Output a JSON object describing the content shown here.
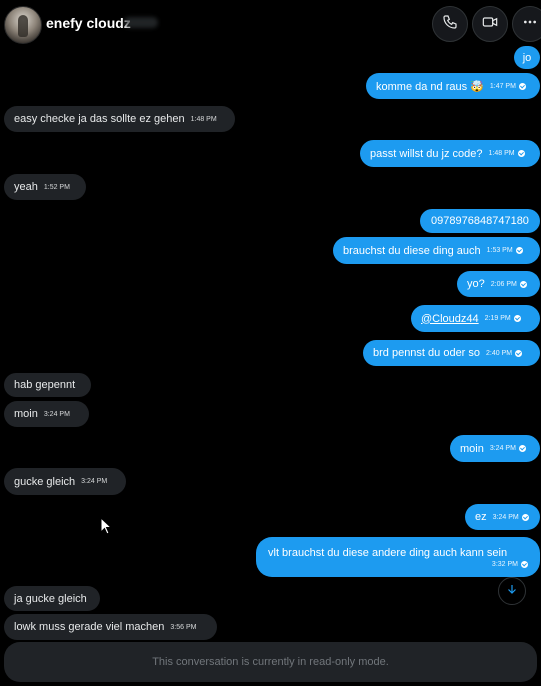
{
  "header": {
    "contact_name": "enefy cloudz",
    "phone_icon": "phone-icon",
    "video_icon": "video-icon",
    "more_icon": "more-horizontal-icon"
  },
  "messages": [
    {
      "dir": "out",
      "text": "jo",
      "time": ""
    },
    {
      "dir": "out",
      "text": "komme da nd raus 🤯",
      "time": "1:47 PM"
    },
    {
      "dir": "in",
      "text": "easy checke ja das sollte ez gehen",
      "time": "1:48 PM"
    },
    {
      "dir": "out",
      "text": "passt willst du jz code?",
      "time": "1:48 PM"
    },
    {
      "dir": "in",
      "text": "yeah",
      "time": "1:52 PM"
    },
    {
      "dir": "out",
      "text": "0978976848747180",
      "time": ""
    },
    {
      "dir": "out",
      "text": "brauchst du diese ding auch",
      "time": "1:53 PM"
    },
    {
      "dir": "out",
      "text": "yo?",
      "time": "2:06 PM"
    },
    {
      "dir": "out",
      "text": "@Cloudz44",
      "time": "2:19 PM"
    },
    {
      "dir": "out",
      "text": "brd pennst du oder so",
      "time": "2:40 PM"
    },
    {
      "dir": "in",
      "text": "hab gepennt",
      "time": ""
    },
    {
      "dir": "in",
      "text": "moin",
      "time": "3:24 PM"
    },
    {
      "dir": "out",
      "text": "moin",
      "time": "3:24 PM"
    },
    {
      "dir": "in",
      "text": "gucke gleich",
      "time": "3:24 PM"
    },
    {
      "dir": "out",
      "text": "ez",
      "time": "3:24 PM"
    },
    {
      "dir": "out",
      "text": "vlt brauchst du diese andere ding auch kann sein",
      "time": "3:32 PM"
    },
    {
      "dir": "in",
      "text": "ja gucke gleich",
      "time": ""
    },
    {
      "dir": "in",
      "text": "lowk muss gerade viel machen",
      "time": "3:56 PM"
    }
  ],
  "footer": {
    "readonly_text": "This conversation is currently in read-only mode."
  },
  "colors": {
    "background": "#000000",
    "outgoing_bubble": "#1d9bf0",
    "incoming_bubble": "#202327"
  }
}
